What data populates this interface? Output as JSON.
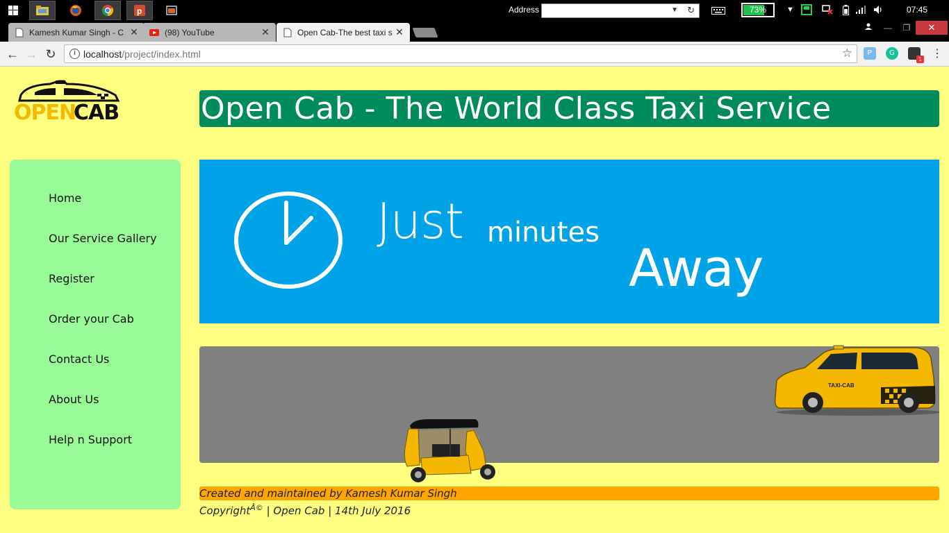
{
  "taskbar": {
    "address_label": "Address",
    "address_value": "",
    "battery_percent": "73%",
    "battery_level": 0.73,
    "clock": "07:45"
  },
  "tabs": [
    {
      "title": "Kamesh Kumar Singh - C"
    },
    {
      "title": "(98) YouTube"
    },
    {
      "title": "Open Cab-The best taxi s"
    }
  ],
  "toolbar": {
    "url_host": "localhost",
    "url_path": "/project/index.html"
  },
  "page": {
    "logo_top": "OPEN",
    "logo_bottom": "CAB",
    "header_title": "Open Cab - The World Class Taxi Service",
    "banner": {
      "just": "Just",
      "minutes": "minutes",
      "away": "Away"
    },
    "nav": [
      {
        "label": "Home"
      },
      {
        "label": "Our Service Gallery"
      },
      {
        "label": "Register"
      },
      {
        "label": "Order your Cab"
      },
      {
        "label": "Contact Us"
      },
      {
        "label": "About Us"
      },
      {
        "label": "Help n Support"
      }
    ],
    "taxi_label": "TAXI-CAB",
    "footer_credit": "Created and maintained by Kamesh Kumar Singh",
    "copyright_word": "Copyright",
    "copyright_symbol": "Â©",
    "copyright_rest": " | Open Cab | 14th July 2016"
  },
  "colors": {
    "page_bg": "#ffff80",
    "header_bg": "#008b5a",
    "sidebar_bg": "#98fb98",
    "banner_bg": "#00a2e8",
    "road_bg": "#808080",
    "footer_bg": "#ffa500",
    "taxi_yellow": "#f5b800"
  }
}
